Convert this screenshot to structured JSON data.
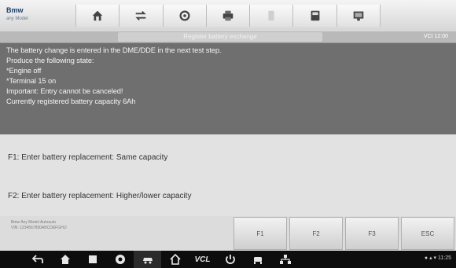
{
  "brand": {
    "name": "Bmw",
    "sub": "any Model"
  },
  "toolbar": {
    "items": [
      {
        "name": "home-icon"
      },
      {
        "name": "vehicle-swap-icon"
      },
      {
        "name": "settings-icon"
      },
      {
        "name": "print-icon"
      },
      {
        "name": "help-icon"
      },
      {
        "name": "save-icon"
      },
      {
        "name": "data-logging-icon"
      }
    ]
  },
  "titlebar": {
    "title": "Register battery exchange",
    "status": "VCI 12:00"
  },
  "message": {
    "lines": [
      "The battery change is entered in the DME/DDE in the next test step.",
      "Produce the following state:",
      "*Engine off",
      "*Terminal 15 on",
      "Important: Entry cannot be canceled!",
      "Currently registered battery capacity 6Ah"
    ]
  },
  "options": [
    {
      "label": "F1: Enter battery replacement: Same capacity"
    },
    {
      "label": "F2: Enter battery replacement: Higher/lower capacity"
    }
  ],
  "vehicle_info": {
    "line1": "Bmw Any Model Autoauto",
    "line2": "VIN: 1234567890ABCDEFGHIJ"
  },
  "function_keys": [
    {
      "label": "F1"
    },
    {
      "label": "F2"
    },
    {
      "label": "F3"
    },
    {
      "label": "ESC"
    }
  ],
  "navbar": {
    "vcl_label": "VCL",
    "status": "● ▴ ▾ 11:25"
  }
}
